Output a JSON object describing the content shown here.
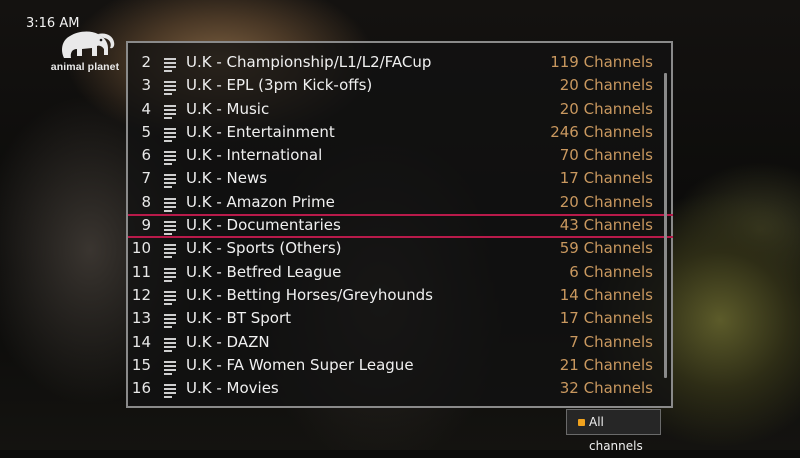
{
  "status": {
    "time": "3:16 AM"
  },
  "logo": {
    "text": "animal planet",
    "icon": "elephant-icon"
  },
  "list": {
    "selected_number": "9",
    "rows": [
      {
        "number": "2",
        "name": "U.K - Championship/L1/L2/FACup",
        "count": "119 Channels"
      },
      {
        "number": "3",
        "name": "U.K - EPL (3pm Kick-offs)",
        "count": "20 Channels"
      },
      {
        "number": "4",
        "name": "U.K - Music",
        "count": "20 Channels"
      },
      {
        "number": "5",
        "name": "U.K - Entertainment",
        "count": "246 Channels"
      },
      {
        "number": "6",
        "name": "U.K - International",
        "count": "70 Channels"
      },
      {
        "number": "7",
        "name": "U.K - News",
        "count": "17 Channels"
      },
      {
        "number": "8",
        "name": "U.K - Amazon Prime",
        "count": "20 Channels"
      },
      {
        "number": "9",
        "name": "U.K - Documentaries",
        "count": "43 Channels"
      },
      {
        "number": "10",
        "name": "U.K - Sports (Others)",
        "count": "59 Channels"
      },
      {
        "number": "11",
        "name": "U.K - Betfred League",
        "count": "6 Channels"
      },
      {
        "number": "12",
        "name": "U.K - Betting Horses/Greyhounds",
        "count": "14 Channels"
      },
      {
        "number": "13",
        "name": "U.K - BT Sport",
        "count": "17 Channels"
      },
      {
        "number": "14",
        "name": "U.K - DAZN",
        "count": "7 Channels"
      },
      {
        "number": "15",
        "name": "U.K - FA Women Super League",
        "count": "21 Channels"
      },
      {
        "number": "16",
        "name": "U.K - Movies",
        "count": "32 Channels"
      }
    ]
  },
  "footer": {
    "filter_label": "All channels",
    "filter_dot_color": "#f0a21e"
  },
  "colors": {
    "accent_selection": "#b81a4a",
    "count_text": "#c9985f"
  }
}
